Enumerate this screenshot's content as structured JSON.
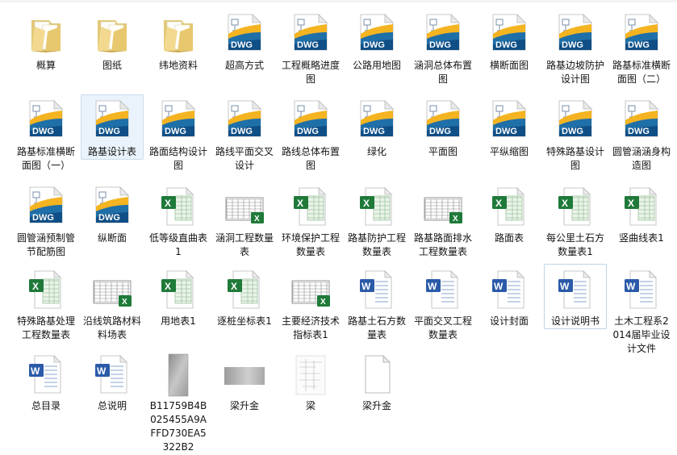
{
  "explorer": {
    "items": [
      {
        "label": "概算",
        "icon": "folder-icon",
        "name": "file-gaisuan"
      },
      {
        "label": "图纸",
        "icon": "folder-icon",
        "name": "file-tuzhi"
      },
      {
        "label": "纬地资料",
        "icon": "folder-icon",
        "name": "file-weidi-ziliao"
      },
      {
        "label": "超高方式",
        "icon": "dwg-icon",
        "name": "file-chaogao-fangshi"
      },
      {
        "label": "工程概略进度图",
        "icon": "dwg-icon",
        "name": "file-gongcheng-jindu"
      },
      {
        "label": "公路用地图",
        "icon": "dwg-icon",
        "name": "file-gonglu-yongdi"
      },
      {
        "label": "涵洞总体布置图",
        "icon": "dwg-icon",
        "name": "file-handong-zongti"
      },
      {
        "label": "横断面图",
        "icon": "dwg-icon",
        "name": "file-hengduanmian"
      },
      {
        "label": "路基边坡防护设计图",
        "icon": "dwg-icon",
        "name": "file-lujibianpo"
      },
      {
        "label": "路基标准横断面图（二）",
        "icon": "dwg-icon",
        "name": "file-luji-biaozhun-2"
      },
      {
        "label": "路基标准横断面图（一）",
        "icon": "dwg-icon",
        "name": "file-luji-biaozhun-1"
      },
      {
        "label": "路基设计表",
        "icon": "dwg-icon",
        "name": "file-luji-shejibiao"
      },
      {
        "label": "路面结构设计图",
        "icon": "dwg-icon",
        "name": "file-lumian-jiegou"
      },
      {
        "label": "路线平面交叉设计",
        "icon": "dwg-icon",
        "name": "file-luxian-jiaocha"
      },
      {
        "label": "路线总体布置图",
        "icon": "dwg-icon",
        "name": "file-luxian-zongti"
      },
      {
        "label": "绿化",
        "icon": "dwg-icon",
        "name": "file-lvhua"
      },
      {
        "label": "平面图",
        "icon": "dwg-icon",
        "name": "file-pingmiantu"
      },
      {
        "label": "平纵缩图",
        "icon": "dwg-icon",
        "name": "file-pingzong"
      },
      {
        "label": "特殊路基设计图",
        "icon": "dwg-icon",
        "name": "file-teshu-luji-sheji"
      },
      {
        "label": "圆管涵涵身构造图",
        "icon": "dwg-icon",
        "name": "file-yuanguan-hanshen"
      },
      {
        "label": "圆管涵预制管节配筋图",
        "icon": "dwg-icon",
        "name": "file-yuanguan-yuzhi"
      },
      {
        "label": "纵断面",
        "icon": "dwg-icon",
        "name": "file-zongduanmian"
      },
      {
        "label": "低等级直曲表1",
        "icon": "excel-icon",
        "name": "file-zhiqubiao"
      },
      {
        "label": "涵洞工程数量表",
        "icon": "table-thumb-icon",
        "name": "file-handong-shuliang"
      },
      {
        "label": "环境保护工程数量表",
        "icon": "excel-icon",
        "name": "file-huanjing-baohu"
      },
      {
        "label": "路基防护工程数量表",
        "icon": "excel-icon",
        "name": "file-luji-fanghu"
      },
      {
        "label": "路基路面排水工程数量表",
        "icon": "table-thumb-icon",
        "name": "file-paishui"
      },
      {
        "label": "路面表",
        "icon": "excel-icon",
        "name": "file-lumianbiao"
      },
      {
        "label": "每公里土石方数量表1",
        "icon": "excel-icon",
        "name": "file-meigongli-tushi"
      },
      {
        "label": "竖曲线表1",
        "icon": "excel-icon",
        "name": "file-shuquxian"
      },
      {
        "label": "特殊路基处理工程数量表",
        "icon": "excel-icon",
        "name": "file-teshu-luji-chuli"
      },
      {
        "label": "沿线筑路材料料场表",
        "icon": "table-thumb-icon",
        "name": "file-zhulu-cailiao"
      },
      {
        "label": "用地表1",
        "icon": "excel-icon",
        "name": "file-yongdibiao"
      },
      {
        "label": "逐桩坐标表1",
        "icon": "excel-icon",
        "name": "file-zhuzhuang-zuobiao"
      },
      {
        "label": "主要经济技术指标表1",
        "icon": "table-thumb-icon",
        "name": "file-jingji-zhibiao"
      },
      {
        "label": "路基土石方数量表",
        "icon": "word-icon",
        "name": "file-luji-tushifang"
      },
      {
        "label": "平面交叉工程数量表",
        "icon": "word-icon",
        "name": "file-pingmian-jiaocha-shuliang"
      },
      {
        "label": "设计封面",
        "icon": "word-icon",
        "name": "file-sheji-fengmian"
      },
      {
        "label": "设计说明书",
        "icon": "word-icon",
        "name": "file-sheji-shuomingshu"
      },
      {
        "label": "土木工程系2014届毕业设计文件",
        "icon": "word-icon",
        "name": "file-biye-sheji"
      },
      {
        "label": "总目录",
        "icon": "word-icon",
        "name": "file-zongmulu"
      },
      {
        "label": "总说明",
        "icon": "word-icon",
        "name": "file-zongshuoming"
      },
      {
        "label": "B11759B4B025455A9AFFD730EA5322B2",
        "icon": "gray-image-icon",
        "name": "file-guid-image"
      },
      {
        "label": "梁升金",
        "icon": "photo-thumb-icon",
        "name": "file-liangshengjin-photo"
      },
      {
        "label": "梁",
        "icon": "sketch-thumb-icon",
        "name": "file-liang"
      },
      {
        "label": "梁升金",
        "icon": "blank-doc-icon",
        "name": "file-liangshengjin-doc"
      }
    ]
  }
}
